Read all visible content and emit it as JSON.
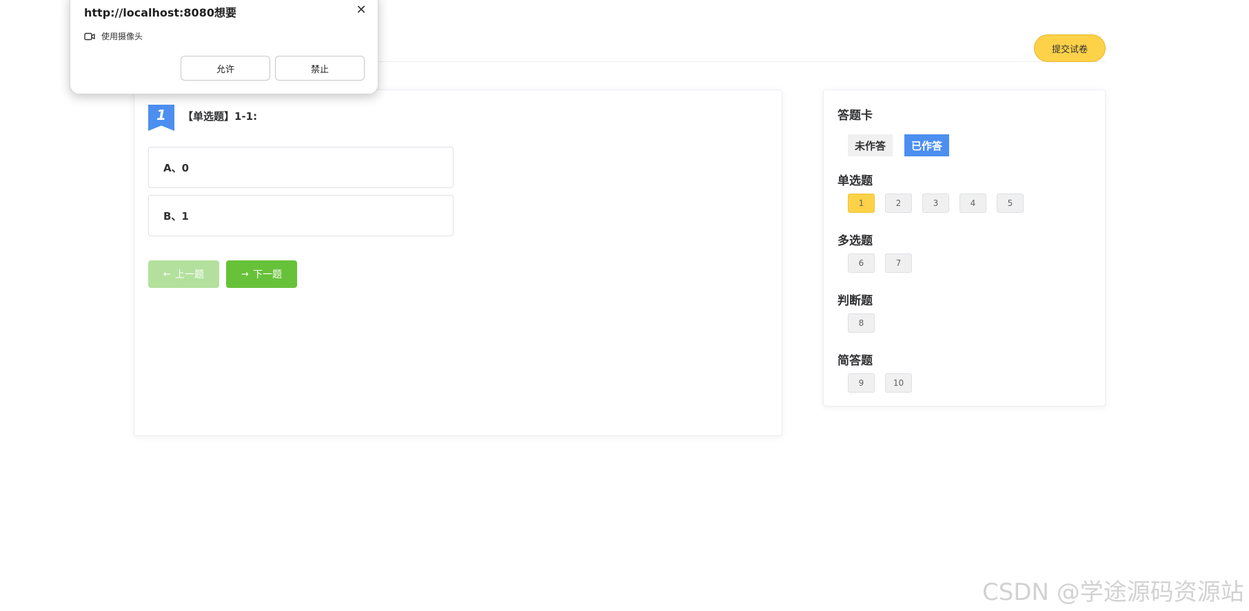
{
  "header": {
    "submit_label": "提交试卷"
  },
  "question": {
    "number": "1",
    "title": "【单选题】1-1:",
    "options": [
      {
        "label": "A、0"
      },
      {
        "label": "B、1"
      }
    ],
    "prev_label": "上一题",
    "next_label": "下一题"
  },
  "answer_card": {
    "title": "答题卡",
    "legend_unanswered": "未作答",
    "legend_answered": "已作答",
    "sections": [
      {
        "title": "单选题",
        "numbers": [
          "1",
          "2",
          "3",
          "4",
          "5"
        ]
      },
      {
        "title": "多选题",
        "numbers": [
          "6",
          "7"
        ]
      },
      {
        "title": "判断题",
        "numbers": [
          "8"
        ]
      },
      {
        "title": "简答题",
        "numbers": [
          "9",
          "10"
        ]
      }
    ],
    "current_question": "1"
  },
  "permission_popup": {
    "title": "http://localhost:8080想要",
    "request": "使用摄像头",
    "allow_label": "允许",
    "block_label": "禁止"
  },
  "watermark": "CSDN @学途源码资源站",
  "colors": {
    "submit": "#fdd249",
    "primary": "#4c8ff0",
    "success": "#67c23a",
    "current": "#fdd249"
  }
}
